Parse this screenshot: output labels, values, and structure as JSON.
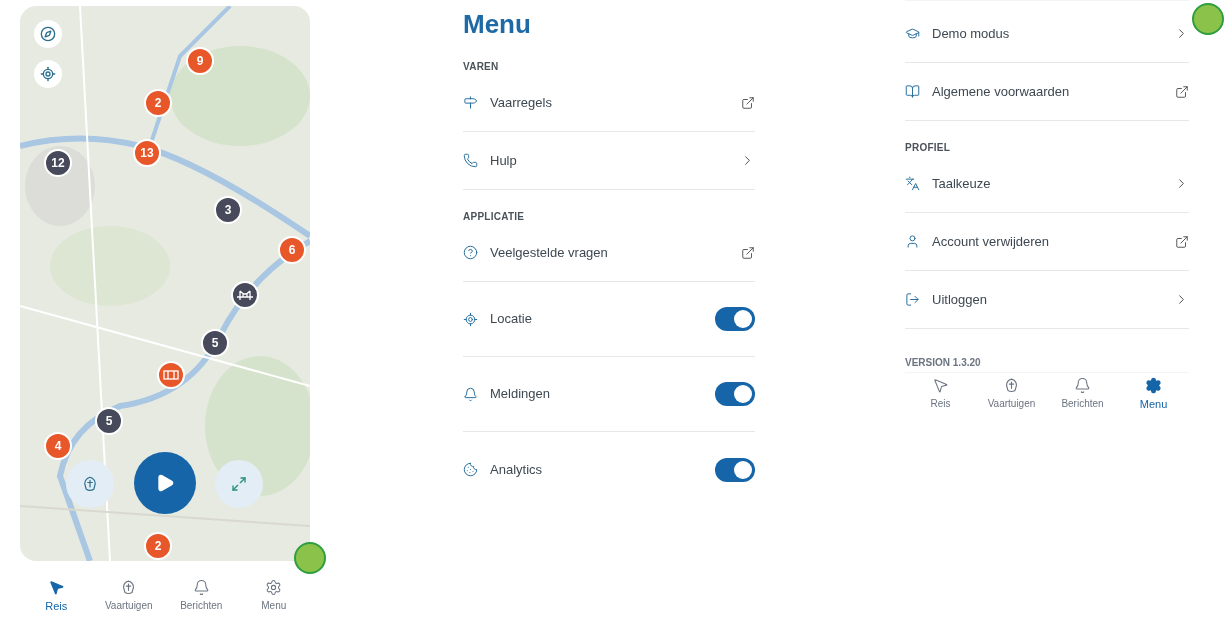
{
  "screens": [
    {
      "kind": "map",
      "markers": [
        {
          "kind": "cluster",
          "label": "9",
          "color": "#e8572a"
        },
        {
          "kind": "cluster",
          "label": "2",
          "color": "#e8572a"
        },
        {
          "kind": "cluster",
          "label": "13",
          "color": "#e8572a"
        },
        {
          "kind": "cluster",
          "label": "12",
          "color": "#464a5a"
        },
        {
          "kind": "cluster",
          "label": "3",
          "color": "#464a5a"
        },
        {
          "kind": "cluster",
          "label": "6",
          "color": "#e8572a"
        },
        {
          "kind": "bridge",
          "color": "#464a5a"
        },
        {
          "kind": "cluster",
          "label": "5",
          "color": "#464a5a"
        },
        {
          "kind": "lock",
          "color": "#e8572a"
        },
        {
          "kind": "cluster",
          "label": "5",
          "color": "#464a5a"
        },
        {
          "kind": "cluster",
          "label": "4",
          "color": "#e8572a"
        },
        {
          "kind": "cluster",
          "label": "2",
          "color": "#e8572a"
        }
      ],
      "nav": [
        {
          "label": "Reis",
          "selected": true
        },
        {
          "label": "Vaartuigen",
          "selected": false
        },
        {
          "label": "Berichten",
          "selected": false
        },
        {
          "label": "Menu",
          "selected": false
        }
      ]
    },
    {
      "kind": "menu",
      "title": "Menu",
      "sections": [
        {
          "header": "VAREN",
          "items": [
            {
              "kind": "external",
              "label": "Vaarregels"
            },
            {
              "kind": "chevron",
              "label": "Hulp"
            }
          ]
        },
        {
          "header": "APPLICATIE",
          "items": [
            {
              "kind": "external",
              "label": "Veelgestelde vragen"
            },
            {
              "kind": "toggle",
              "label": "Locatie",
              "on": true
            },
            {
              "kind": "toggle",
              "label": "Meldingen",
              "on": true
            },
            {
              "kind": "toggle",
              "label": "Analytics",
              "on": true
            }
          ]
        }
      ]
    },
    {
      "kind": "menu",
      "sections": [
        {
          "items": [
            {
              "kind": "chevron",
              "label": "Demo modus"
            },
            {
              "kind": "external",
              "label": "Algemene voorwaarden"
            }
          ]
        },
        {
          "header": "PROFIEL",
          "items": [
            {
              "kind": "chevron",
              "label": "Taalkeuze"
            },
            {
              "kind": "external",
              "label": "Account verwijderen"
            },
            {
              "kind": "chevron",
              "label": "Uitloggen"
            }
          ]
        }
      ],
      "version": "VERSION 1.3.20",
      "nav": [
        {
          "label": "Reis",
          "selected": false
        },
        {
          "label": "Vaartuigen",
          "selected": false
        },
        {
          "label": "Berichten",
          "selected": false
        },
        {
          "label": "Menu",
          "selected": true
        }
      ]
    }
  ]
}
